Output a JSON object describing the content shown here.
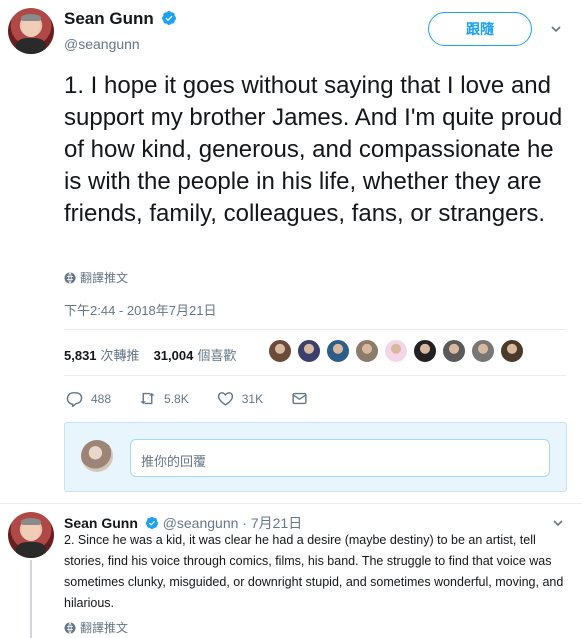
{
  "tweet": {
    "author_name": "Sean Gunn",
    "author_handle": "@seangunn",
    "follow_label": "跟隨",
    "text": "1. I hope it goes without saying that I love and support my brother James. And I'm quite proud of how kind, generous, and compassionate he is with the people in his life, whether they are friends, family, colleagues, fans, or strangers.",
    "translate_label": "翻譯推文",
    "timestamp": "下午2:44 - 2018年7月21日",
    "retweets_count": "5,831",
    "retweets_label": "次轉推",
    "likes_count": "31,004",
    "likes_label": "個喜歡",
    "liker_colors": [
      "#6b4a3a",
      "#3a3f6b",
      "#2f5d8a",
      "#8c7b6a",
      "#f5d6e6",
      "#222222",
      "#5a5a5a",
      "#777777",
      "#4a3a2a"
    ],
    "actions": {
      "reply_count": "488",
      "retweet_count": "5.8K",
      "like_count": "31K"
    }
  },
  "reply_box": {
    "placeholder": "推你的回覆"
  },
  "reply_tweet": {
    "author_name": "Sean Gunn",
    "author_handle": "@seangunn",
    "time": "· 7月21日",
    "text": "2. Since he was a kid, it was clear he had a desire (maybe destiny) to be an artist, tell stories, find his voice through comics, films, his band. The struggle to find that voice was sometimes clunky, misguided, or downright stupid, and sometimes wonderful, moving, and hilarious.",
    "translate_label": "翻譯推文"
  },
  "colors": {
    "brand": "#1da1f2",
    "secondary_text": "#657786",
    "primary_text": "#14171a"
  }
}
